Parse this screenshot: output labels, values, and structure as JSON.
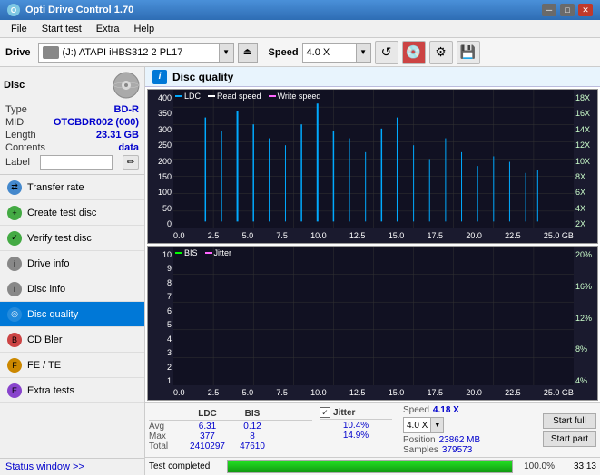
{
  "titleBar": {
    "title": "Opti Drive Control 1.70",
    "icon": "O"
  },
  "menuBar": {
    "items": [
      "File",
      "Start test",
      "Extra",
      "Help"
    ]
  },
  "toolbar": {
    "driveLabel": "Drive",
    "driveName": "(J:)  ATAPI iHBS312  2 PL17",
    "speedLabel": "Speed",
    "speedValue": "4.0 X"
  },
  "sidebar": {
    "discSection": {
      "label": "Disc",
      "typeLabel": "Type",
      "typeValue": "BD-R",
      "midLabel": "MID",
      "midValue": "OTCBDR002 (000)",
      "lengthLabel": "Length",
      "lengthValue": "23.31 GB",
      "contentsLabel": "Contents",
      "contentsValue": "data",
      "labelLabel": "Label",
      "labelValue": ""
    },
    "navItems": [
      {
        "id": "transfer-rate",
        "label": "Transfer rate",
        "active": false
      },
      {
        "id": "create-test-disc",
        "label": "Create test disc",
        "active": false
      },
      {
        "id": "verify-test-disc",
        "label": "Verify test disc",
        "active": false
      },
      {
        "id": "drive-info",
        "label": "Drive info",
        "active": false
      },
      {
        "id": "disc-info",
        "label": "Disc info",
        "active": false
      },
      {
        "id": "disc-quality",
        "label": "Disc quality",
        "active": true
      },
      {
        "id": "cd-bler",
        "label": "CD Bler",
        "active": false
      },
      {
        "id": "fe-te",
        "label": "FE / TE",
        "active": false
      },
      {
        "id": "extra-tests",
        "label": "Extra tests",
        "active": false
      }
    ],
    "statusWindow": "Status window >>"
  },
  "discQuality": {
    "title": "Disc quality",
    "chart1": {
      "legend": [
        {
          "label": "LDC",
          "color": "#00aaff"
        },
        {
          "label": "Read speed",
          "color": "#ffffff"
        },
        {
          "label": "Write speed",
          "color": "#ff66ff"
        }
      ],
      "yAxisLeft": [
        "400",
        "350",
        "300",
        "250",
        "200",
        "150",
        "100",
        "50",
        "0"
      ],
      "yAxisRight": [
        "18X",
        "16X",
        "14X",
        "12X",
        "10X",
        "8X",
        "6X",
        "4X",
        "2X"
      ],
      "xAxis": [
        "0.0",
        "2.5",
        "5.0",
        "7.5",
        "10.0",
        "12.5",
        "15.0",
        "17.5",
        "20.0",
        "22.5",
        "25.0 GB"
      ]
    },
    "chart2": {
      "legend": [
        {
          "label": "BIS",
          "color": "#00ff00"
        },
        {
          "label": "Jitter",
          "color": "#ff66ff"
        }
      ],
      "yAxisLeft": [
        "10",
        "9",
        "8",
        "7",
        "6",
        "5",
        "4",
        "3",
        "2",
        "1"
      ],
      "yAxisRight": [
        "20%",
        "16%",
        "12%",
        "8%",
        "4%"
      ],
      "xAxis": [
        "0.0",
        "2.5",
        "5.0",
        "7.5",
        "10.0",
        "12.5",
        "15.0",
        "17.5",
        "20.0",
        "22.5",
        "25.0 GB"
      ]
    },
    "stats": {
      "columns": [
        "LDC",
        "BIS"
      ],
      "jitterLabel": "Jitter",
      "jitterChecked": true,
      "rows": [
        {
          "label": "Avg",
          "ldc": "6.31",
          "bis": "0.12",
          "jitter": "10.4%"
        },
        {
          "label": "Max",
          "ldc": "377",
          "bis": "8",
          "jitter": "14.9%"
        },
        {
          "label": "Total",
          "ldc": "2410297",
          "bis": "47610",
          "jitter": ""
        }
      ],
      "speedLabel": "Speed",
      "speedValue": "4.18 X",
      "speedSelect": "4.0 X",
      "positionLabel": "Position",
      "positionValue": "23862 MB",
      "samplesLabel": "Samples",
      "samplesValue": "379573",
      "startFull": "Start full",
      "startPart": "Start part"
    }
  },
  "statusBar": {
    "statusText": "Test completed",
    "progressPercent": 100,
    "progressDisplay": "100.0%",
    "timeDisplay": "33:13"
  }
}
